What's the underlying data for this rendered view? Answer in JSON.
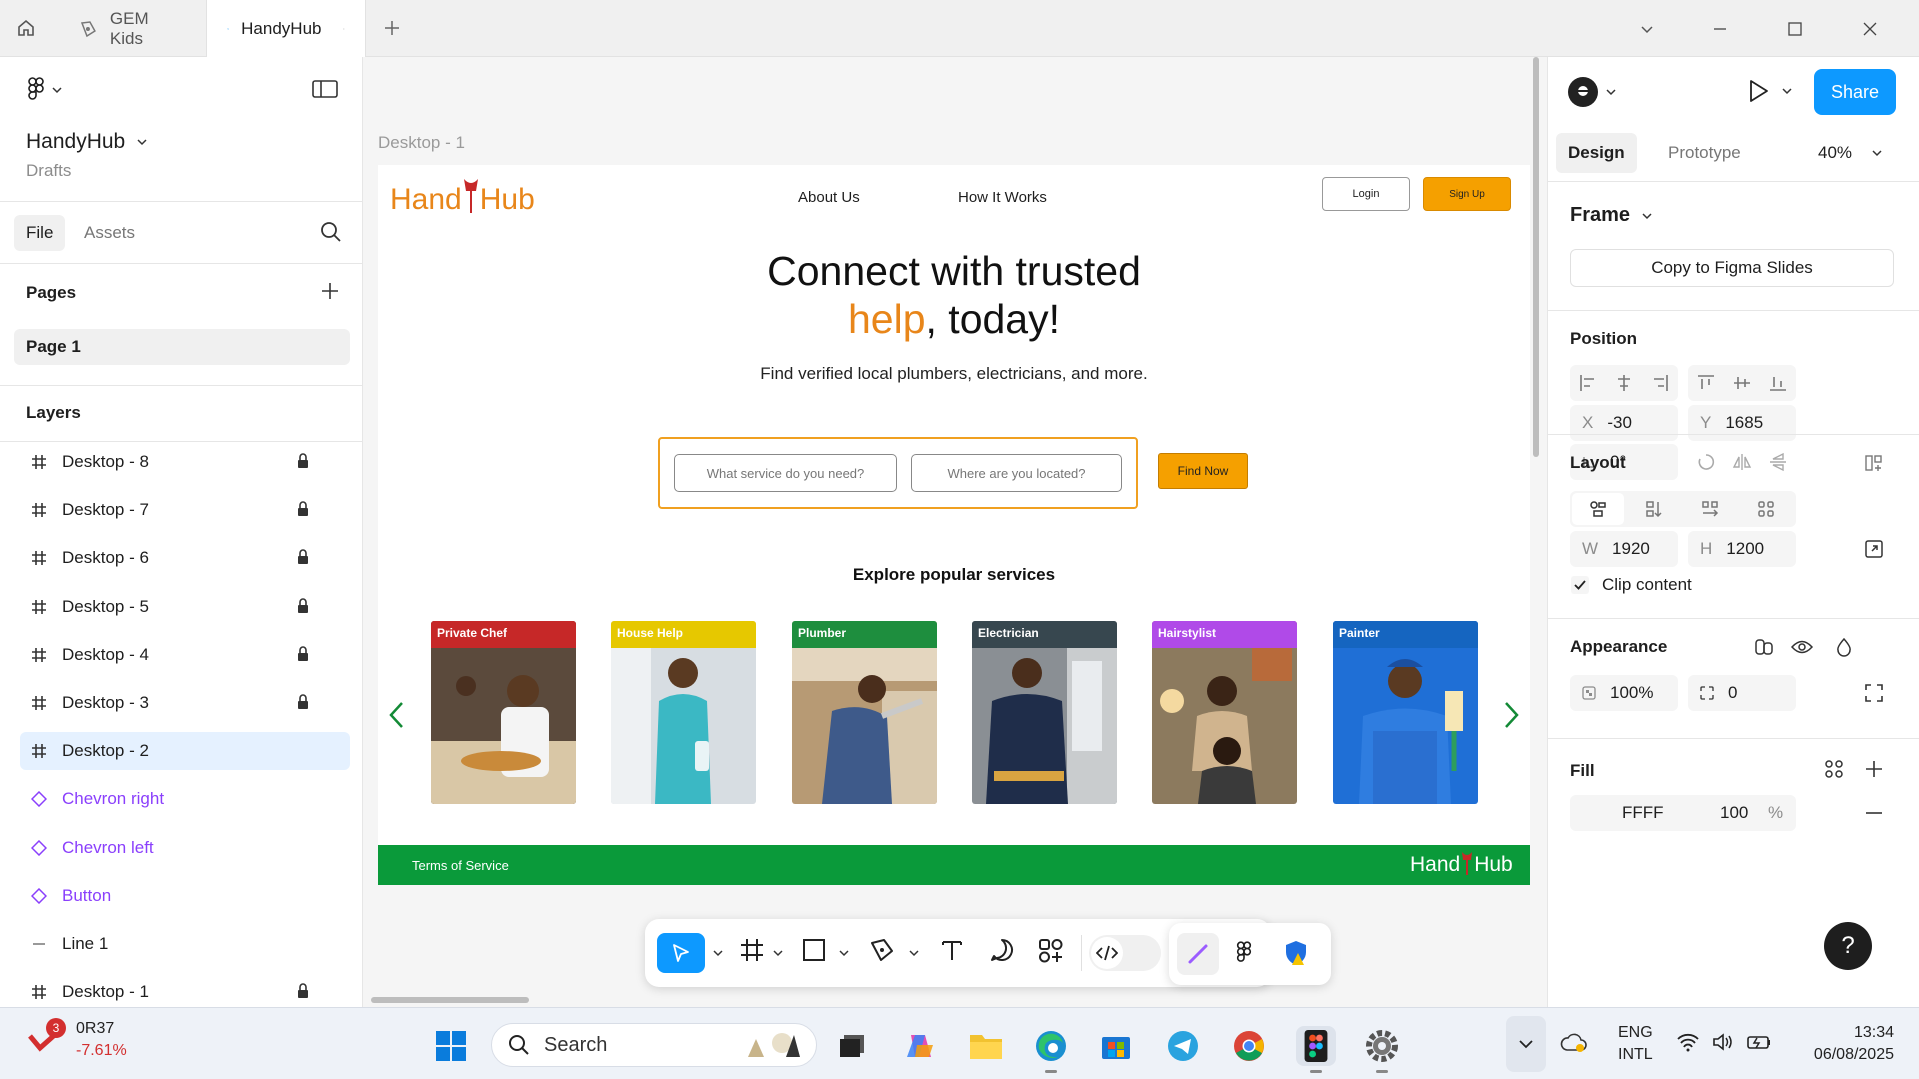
{
  "browser": {
    "tabs": [
      {
        "label": "GEM Kids",
        "icon": "figma-file-icon",
        "active": false
      },
      {
        "label": "HandyHub",
        "icon": "figma-file-icon",
        "active": true
      }
    ]
  },
  "left_panel": {
    "file_name": "HandyHub",
    "file_location": "Drafts",
    "tabs": [
      "File",
      "Assets"
    ],
    "pages_title": "Pages",
    "pages": [
      "Page 1"
    ],
    "layers_title": "Layers",
    "layers": [
      {
        "name": "Desktop - 8",
        "type": "frame",
        "locked": true
      },
      {
        "name": "Desktop - 7",
        "type": "frame",
        "locked": true
      },
      {
        "name": "Desktop - 6",
        "type": "frame",
        "locked": true
      },
      {
        "name": "Desktop - 5",
        "type": "frame",
        "locked": true
      },
      {
        "name": "Desktop - 4",
        "type": "frame",
        "locked": true
      },
      {
        "name": "Desktop - 3",
        "type": "frame",
        "locked": true
      },
      {
        "name": "Desktop - 2",
        "type": "frame",
        "locked": false,
        "selected": true
      },
      {
        "name": "Chevron right",
        "type": "component",
        "locked": false
      },
      {
        "name": "Chevron left",
        "type": "component",
        "locked": false
      },
      {
        "name": "Button",
        "type": "component",
        "locked": false
      },
      {
        "name": "Line 1",
        "type": "line",
        "locked": false
      },
      {
        "name": "Desktop - 1",
        "type": "frame",
        "locked": true
      }
    ]
  },
  "canvas": {
    "frame_label": "Desktop - 1",
    "site": {
      "logo_left": "Hand",
      "logo_right": "Hub",
      "nav": [
        "About Us",
        "How It Works"
      ],
      "login_label": "Login",
      "signup_label": "Sign Up",
      "hero_line1": "Connect with trusted",
      "hero_highlight": "help",
      "hero_line2_rest": ", today!",
      "hero_sub": "Find verified local plumbers, electricians, and more.",
      "search_service_placeholder": "What service do you need?",
      "search_location_placeholder": "Where are you located?",
      "find_button": "Find Now",
      "services_title": "Explore popular services",
      "services": [
        {
          "label": "Private Chef",
          "color": "#c62828"
        },
        {
          "label": "House Help",
          "color": "#e6c800"
        },
        {
          "label": "Plumber",
          "color": "#1e8e3e"
        },
        {
          "label": "Electrician",
          "color": "#37474f"
        },
        {
          "label": "Hairstylist",
          "color": "#b04ae8"
        },
        {
          "label": "Painter",
          "color": "#1565c0"
        }
      ],
      "footer_terms": "Terms of Service",
      "footer_logo_left": "Hand",
      "footer_logo_right": "Hub"
    }
  },
  "toolbar": {
    "tools": [
      "move-tool",
      "frame-tool",
      "shape-tool",
      "pen-tool",
      "text-tool",
      "comment-tool",
      "actions-tool",
      "dev-mode-toggle"
    ]
  },
  "right_panel": {
    "share_label": "Share",
    "tabs": [
      "Design",
      "Prototype"
    ],
    "zoom": "40%",
    "frame_title": "Frame",
    "copy_slides_label": "Copy to Figma Slides",
    "position_title": "Position",
    "x_label": "X",
    "x_value": "-30",
    "y_label": "Y",
    "y_value": "1685",
    "rotation_value": "0°",
    "layout_title": "Layout",
    "w_label": "W",
    "w_value": "1920",
    "h_label": "H",
    "h_value": "1200",
    "clip_content_label": "Clip content",
    "clip_content_checked": true,
    "appearance_title": "Appearance",
    "opacity_value": "100%",
    "radius_value": "0",
    "fill_title": "Fill",
    "fill_hex": "FFFF",
    "fill_opacity": "100",
    "fill_percent": "%",
    "help_label": "?"
  },
  "taskbar": {
    "stock_ticker": "0R37",
    "stock_change": "-7.61%",
    "notification_count": "3",
    "search_placeholder": "Search",
    "language_line1": "ENG",
    "language_line2": "INTL",
    "time": "13:34",
    "date": "06/08/2025"
  },
  "colors": {
    "brand_orange": "#e8861a",
    "button_orange": "#f5a000",
    "footer_green": "#0a9a3a",
    "figma_blue": "#0d99ff",
    "selection_bg": "#e5f1ff"
  }
}
